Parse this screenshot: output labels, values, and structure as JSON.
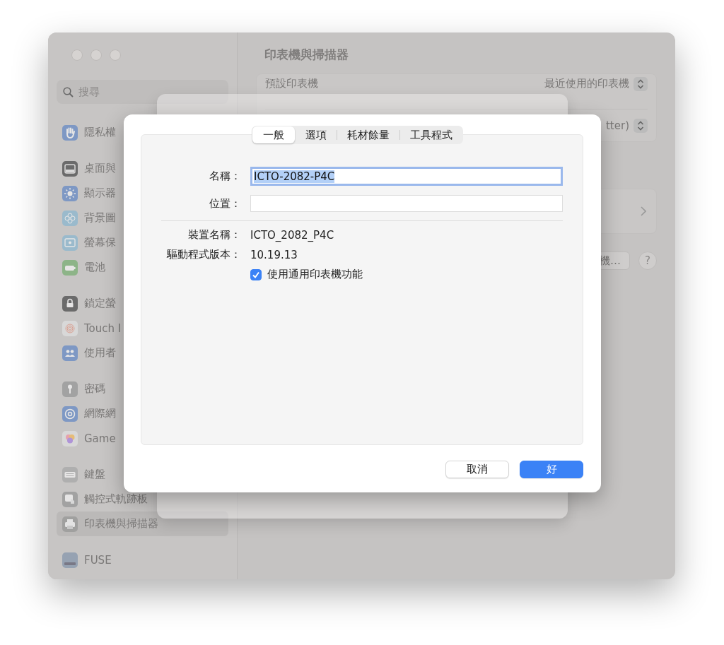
{
  "window": {
    "title": "印表機與掃描器"
  },
  "sidebar": {
    "search": {
      "placeholder": "搜尋"
    },
    "groups": [
      [
        {
          "label": "隱私權",
          "kind": "hand",
          "selected": false
        }
      ],
      [
        {
          "label": "桌面與",
          "kind": "desktop",
          "selected": false
        },
        {
          "label": "顯示器",
          "kind": "sun",
          "selected": false
        },
        {
          "label": "背景圖",
          "kind": "flower",
          "selected": false
        },
        {
          "label": "螢幕保",
          "kind": "screensaver",
          "selected": false
        },
        {
          "label": "電池",
          "kind": "battery",
          "selected": false
        }
      ],
      [
        {
          "label": "鎖定螢",
          "kind": "lock",
          "selected": false
        },
        {
          "label": "Touch I",
          "kind": "fingerprint",
          "selected": false
        },
        {
          "label": "使用者",
          "kind": "people",
          "selected": false
        }
      ],
      [
        {
          "label": "密碼",
          "kind": "key",
          "selected": false
        },
        {
          "label": "網際網",
          "kind": "at",
          "selected": false
        },
        {
          "label": "Game",
          "kind": "game",
          "selected": false
        }
      ],
      [
        {
          "label": "鍵盤",
          "kind": "keyboard",
          "selected": false
        },
        {
          "label": "觸控式軌跡板",
          "kind": "trackpad",
          "selected": false
        },
        {
          "label": "印表機與掃描器",
          "kind": "printer",
          "selected": true
        }
      ],
      [
        {
          "label": "FUSE",
          "kind": "drive",
          "selected": false
        }
      ]
    ]
  },
  "content": {
    "default_printer": {
      "label": "預設印表機",
      "value": "最近使用的印表機"
    },
    "paper_size": {
      "value": "tter)"
    },
    "add_button": "機…",
    "help_button": "?"
  },
  "dialog": {
    "tabs": [
      {
        "label": "一般",
        "selected": true
      },
      {
        "label": "選項",
        "selected": false
      },
      {
        "label": "耗材餘量",
        "selected": false
      },
      {
        "label": "工具程式",
        "selected": false
      }
    ],
    "name": {
      "label": "名稱：",
      "value": "ICTO-2082-P4C"
    },
    "location": {
      "label": "位置："
    },
    "info": [
      {
        "label": "裝置名稱：",
        "value": "ICTO_2082_P4C"
      },
      {
        "label": "驅動程式版本：",
        "value": "10.19.13"
      }
    ],
    "generic_printer": {
      "label": "使用通用印表機功能",
      "checked": true
    },
    "buttons": {
      "cancel": "取消",
      "ok": "好"
    }
  }
}
